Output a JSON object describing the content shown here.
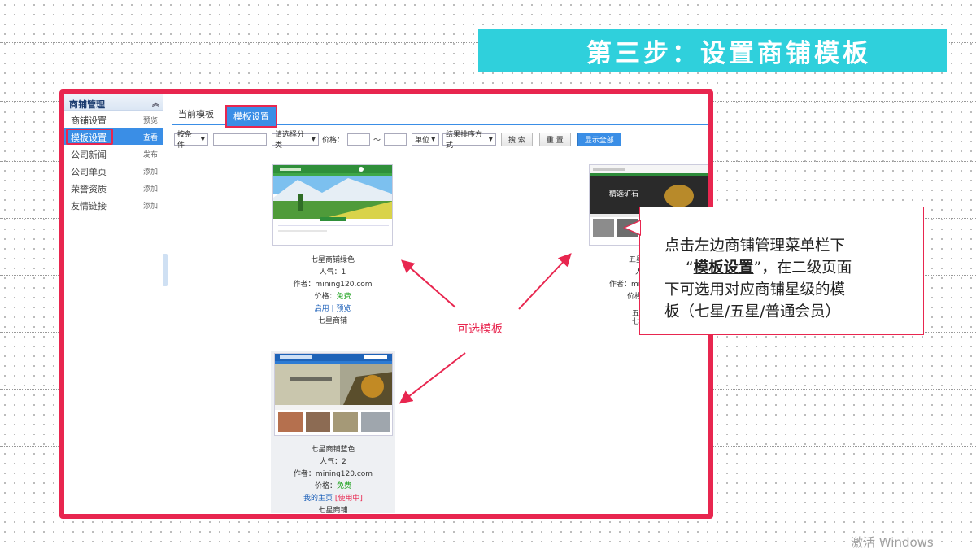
{
  "slide": {
    "title": "第三步：设置商铺模板",
    "optional_label": "可选模板",
    "callout": {
      "line1": "点击左边商铺管理菜单栏下",
      "quote_open": "“",
      "bold_term": "模板设置",
      "quote_close": "”",
      "line2_rest": "，在二级页面",
      "line3": "下可选用对应商铺星级的模",
      "line4": "板（七星/五星/普通会员）"
    },
    "watermark": "激活 Windows",
    "colors": {
      "accent_red": "#e8264f",
      "banner": "#2fd0dc",
      "blue": "#3a8ee6"
    }
  },
  "sidebar": {
    "header": "商铺管理",
    "collapse_icon": "double-chevron-up-icon",
    "items": [
      {
        "label": "商铺设置",
        "action": "预览"
      },
      {
        "label": "模板设置",
        "action": "查看"
      },
      {
        "label": "公司新闻",
        "action": "发布"
      },
      {
        "label": "公司单页",
        "action": "添加"
      },
      {
        "label": "荣誉资质",
        "action": "添加"
      },
      {
        "label": "友情链接",
        "action": "添加"
      }
    ]
  },
  "tabs": {
    "current": "当前模板",
    "active": "模板设置"
  },
  "filters": {
    "condition": "按条件",
    "category": "请选择分类",
    "price_label": "价格：",
    "tilde": "～",
    "unit": "单位",
    "sort": "结果排序方式",
    "search": "搜 索",
    "reset": "重 置",
    "show_all": "显示全部"
  },
  "templates": [
    {
      "name": "七星商铺绿色",
      "popularity": "人气：1",
      "author_label": "作者：",
      "author": "mining120.com",
      "price_label": "价格：",
      "price": "免费",
      "action1": "启用",
      "sep": "|",
      "action2": "预览",
      "level": "七星商铺"
    },
    {
      "name": "七星商铺蓝色",
      "popularity": "人气：2",
      "author_label": "作者：",
      "author": "mining120.com",
      "price_label": "价格：",
      "price": "免费",
      "action1": "我的主页",
      "in_use": "[使用中]",
      "level": "七星商铺"
    },
    {
      "name_partial": "五星",
      "popularity_partial": "人",
      "author_partial": "作者：mi",
      "price_partial": "价格",
      "line5_partial": "五",
      "line6_partial": "七",
      "thumb_text": "精选矿石"
    }
  ]
}
